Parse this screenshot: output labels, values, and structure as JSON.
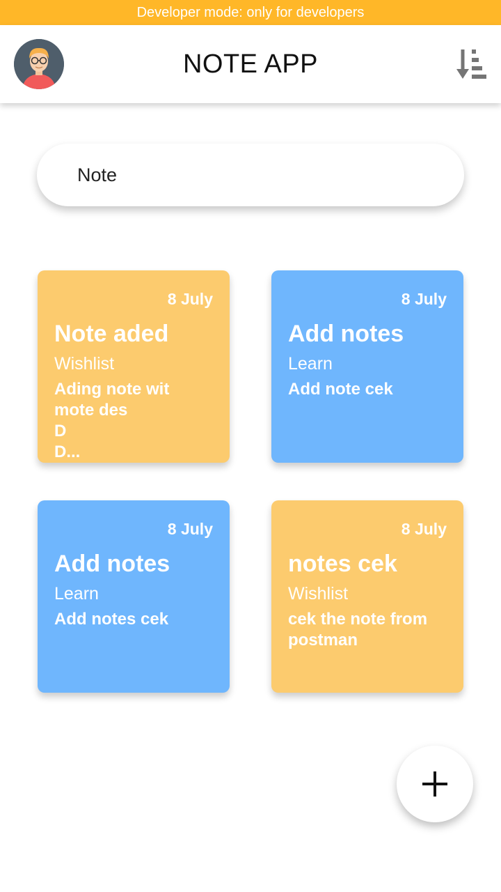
{
  "status_banner": "Developer mode: only for developers",
  "app_bar": {
    "title": "NOTE APP",
    "avatar_icon": "user-avatar-icon",
    "sort_icon": "sort-descending-icon"
  },
  "search": {
    "value": "Note",
    "placeholder": "Note"
  },
  "colors": {
    "banner": "#FFB728",
    "wishlist": "#FCCB6E",
    "learn": "#6FB6FD"
  },
  "notes": [
    {
      "date": "8 July",
      "title": "Note aded",
      "category": "Wishlist",
      "description": "Ading note wit\nmote des\nD\nD...",
      "color": "#FCCB6E"
    },
    {
      "date": "8 July",
      "title": "Add notes",
      "category": "Learn",
      "description": "Add note cek",
      "color": "#6FB6FD"
    },
    {
      "date": "8 July",
      "title": "Add notes",
      "category": "Learn",
      "description": "Add notes cek",
      "color": "#6FB6FD"
    },
    {
      "date": "8 July",
      "title": "notes cek",
      "category": "Wishlist",
      "description": "cek the note from\npostman",
      "color": "#FCCB6E"
    }
  ],
  "fab": {
    "icon": "plus-icon"
  }
}
